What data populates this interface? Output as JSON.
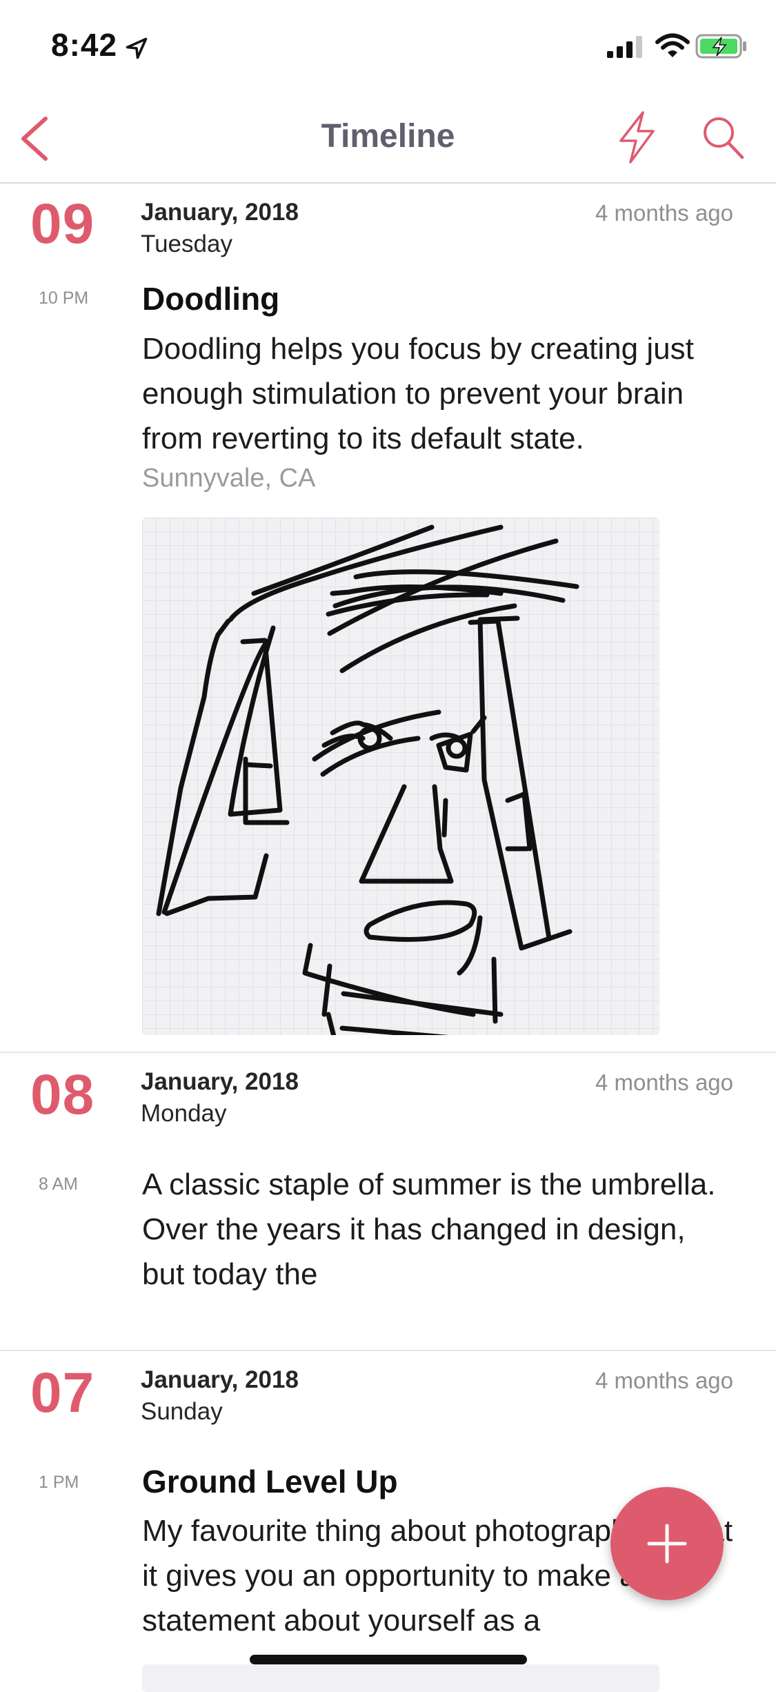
{
  "status_bar": {
    "time": "8:42"
  },
  "nav": {
    "title": "Timeline"
  },
  "entries": [
    {
      "day": "09",
      "month_year": "January, 2018",
      "weekday": "Tuesday",
      "relative": "4 months ago",
      "time": "10 PM",
      "title": "Doodling",
      "body": "Doodling helps you focus by creating just enough stimulation to prevent your brain from reverting to its default state.",
      "location": "Sunnyvale, CA"
    },
    {
      "day": "08",
      "month_year": "January, 2018",
      "weekday": "Monday",
      "relative": "4 months ago",
      "time": "8 AM",
      "body": "A classic staple of summer is the umbrella. Over the years it has changed in design, but today the"
    },
    {
      "day": "07",
      "month_year": "January, 2018",
      "weekday": "Sunday",
      "relative": "4 months ago",
      "time": "1 PM",
      "title": "Ground Level Up",
      "body": "My favourite thing about photography is that it gives you an opportunity to make a statement about yourself as a"
    }
  ],
  "colors": {
    "accent": "#de5b6e",
    "nav_title": "#5f5f6e",
    "muted": "#8e8e93",
    "battery": "#4cd964"
  }
}
